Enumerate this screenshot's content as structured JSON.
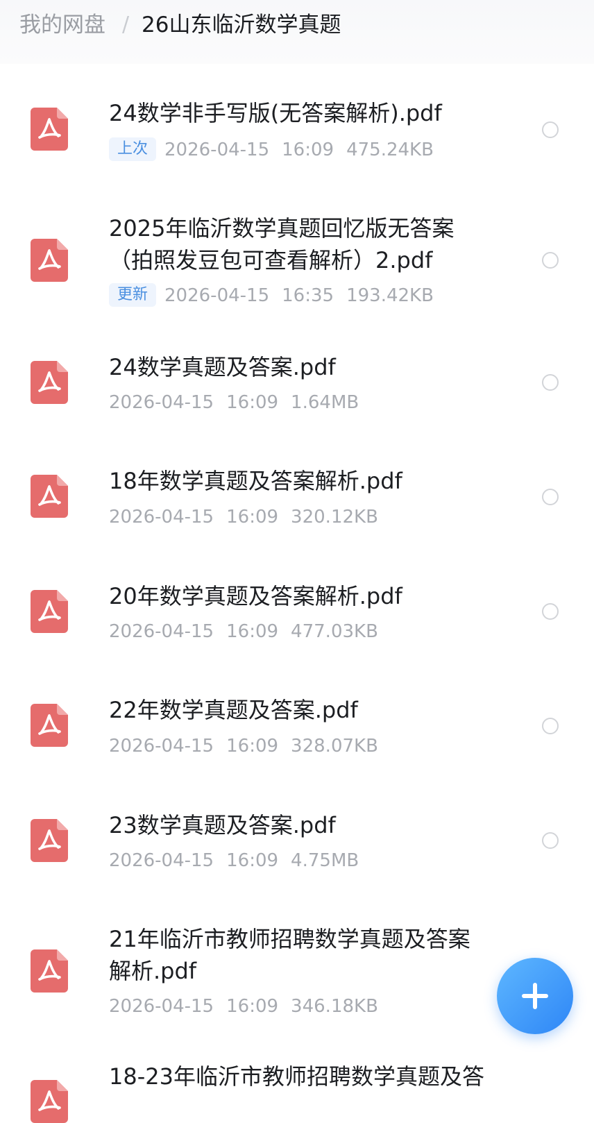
{
  "breadcrumb": {
    "root": "我的网盘",
    "separator": "/",
    "current": "26山东临沂数学真题"
  },
  "files": [
    {
      "name_lines": [
        "24数学非手写版(无答案解析).pdf"
      ],
      "tag": "上次",
      "date": "2026-04-15",
      "time": "16:09",
      "size": "475.24KB",
      "icon": "pdf-icon"
    },
    {
      "name_lines": [
        "2025年临沂数学真题回忆版无答案",
        "（拍照发豆包可查看解析）2.pdf"
      ],
      "tag": "更新",
      "date": "2026-04-15",
      "time": "16:35",
      "size": "193.42KB",
      "icon": "pdf-icon"
    },
    {
      "name_lines": [
        "24数学真题及答案.pdf"
      ],
      "tag": "",
      "date": "2026-04-15",
      "time": "16:09",
      "size": "1.64MB",
      "icon": "pdf-icon"
    },
    {
      "name_lines": [
        "18年数学真题及答案解析.pdf"
      ],
      "tag": "",
      "date": "2026-04-15",
      "time": "16:09",
      "size": "320.12KB",
      "icon": "pdf-icon"
    },
    {
      "name_lines": [
        "20年数学真题及答案解析.pdf"
      ],
      "tag": "",
      "date": "2026-04-15",
      "time": "16:09",
      "size": "477.03KB",
      "icon": "pdf-icon"
    },
    {
      "name_lines": [
        "22年数学真题及答案.pdf"
      ],
      "tag": "",
      "date": "2026-04-15",
      "time": "16:09",
      "size": "328.07KB",
      "icon": "pdf-icon"
    },
    {
      "name_lines": [
        "23数学真题及答案.pdf"
      ],
      "tag": "",
      "date": "2026-04-15",
      "time": "16:09",
      "size": "4.75MB",
      "icon": "pdf-icon"
    },
    {
      "name_lines": [
        "21年临沂市教师招聘数学真题及答案",
        "解析.pdf"
      ],
      "tag": "",
      "date": "2026-04-15",
      "time": "16:09",
      "size": "346.18KB",
      "icon": "pdf-icon"
    },
    {
      "name_lines": [
        "18-23年临沂市教师招聘数学真题及答"
      ],
      "tag": "",
      "date": "",
      "time": "",
      "size": "",
      "icon": "pdf-icon"
    }
  ],
  "fab": {
    "icon": "plus-icon",
    "color": "#2e86f6"
  },
  "colors": {
    "pdf_icon": "#e56c6c",
    "tag_text": "#4a8fe0",
    "meta_text": "#a7aab0"
  }
}
